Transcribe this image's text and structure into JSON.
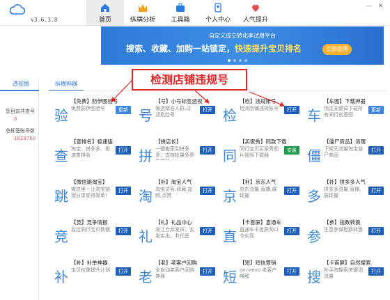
{
  "app": {
    "version": "v3.6.3.8"
  },
  "nav": {
    "items": [
      {
        "label": "首页",
        "icon": "home-icon",
        "active": true
      },
      {
        "label": "纵横分析",
        "icon": "analysis-icon",
        "active": false
      },
      {
        "label": "工具箱",
        "icon": "toolbox-icon",
        "active": false
      },
      {
        "label": "个人中心",
        "icon": "user-icon",
        "active": false
      },
      {
        "label": "人气提升",
        "icon": "popularity-icon",
        "active": false
      }
    ]
  },
  "banner": {
    "subtitle": "自定义成交转化率试用平台",
    "headline_part1": "搜索、收藏、加购一站锁定，",
    "headline_part2": "快速提升宝贝排名",
    "cta": "立即使用"
  },
  "left": {
    "tab": "透视镜",
    "stat1_label": "您目前共查号",
    "stat1_value": "0",
    "stat2_label": "总标签账号数",
    "stat2_value": "1629760"
  },
  "main": {
    "tab": "纵横神器"
  },
  "annotation": {
    "text": "检测店铺违规号"
  },
  "tools": [
    {
      "char": "验",
      "title": "【免费】防伊图验号",
      "desc": "免费防伊图验号",
      "button": "更新",
      "button_style": "light"
    },
    {
      "char": "号",
      "title": "【号】小号标签透视",
      "desc": "筛选精准人群,过滤危险号",
      "button": "打开",
      "button_style": "blue"
    },
    {
      "char": "检",
      "title": "【检】违规账号",
      "desc": "检测店铺违规账号",
      "button": "打开",
      "button_style": "blue"
    },
    {
      "char": "车",
      "title": "【车图】下载神器",
      "desc": "指定关键词下载所有同行创意图",
      "button": "更新",
      "button_style": "light"
    },
    {
      "char": "查",
      "title": "【查排名】极速版",
      "desc": "淘宝、拼多多、极速查排名",
      "button": "打开",
      "button_style": "blue"
    },
    {
      "char": "拼",
      "title": "【拼店长】",
      "desc": "一键搬家到拼多多，支持批量多票车神器",
      "button": "打开",
      "button_style": "blue"
    },
    {
      "char": "同",
      "title": "【买家秀】同款下载",
      "desc": "同行宝贝买家秀图片视频下载器",
      "button": "安装",
      "button_style": "green"
    },
    {
      "char": "僵",
      "title": "【僵尸商品】清理",
      "desc": "下架无流量淘宝僵尸商品",
      "button": "打开",
      "button_style": "blue"
    },
    {
      "char": "跳",
      "title": "【微信跳淘宝】",
      "desc": "微信里－让淘宝链接分享变得简单！",
      "button": "打开",
      "button_style": "blue"
    },
    {
      "char": "淘",
      "title": "【补】淘宝人气",
      "desc": "淘宝访客,收藏,加购,点赞",
      "button": "打开",
      "button_style": "blue"
    },
    {
      "char": "京",
      "title": "【补】京东人气",
      "desc": "京东流量,直播,展现量",
      "button": "打开",
      "button_style": "blue"
    },
    {
      "char": "多",
      "title": "【补】拼多多人气",
      "desc": "拼多多流量,直播,展现量",
      "button": "打开",
      "button_style": "blue"
    },
    {
      "char": "竞",
      "title": "【竞】竞争情报",
      "desc": "监控同行宝贝数据",
      "button": "打开",
      "button_style": "blue"
    },
    {
      "char": "礼",
      "title": "【礼】礼品中心",
      "desc": "浙江仓库发货，实发实出，非代签",
      "button": "打开",
      "button_style": "blue"
    },
    {
      "char": "直",
      "title": "【卡首屏】直通车",
      "desc": "直通车卡首屏淘口令实现",
      "button": "打开",
      "button_style": "blue"
    },
    {
      "char": "参",
      "title": "【参】指数转换",
      "desc": "生意参谋指数转换",
      "button": "打开",
      "button_style": "blue"
    },
    {
      "char": "补",
      "title": "【补】补单神器",
      "desc": "宝贝权重提升计划",
      "button": "打开",
      "button_style": "blue"
    },
    {
      "char": "老",
      "title": "【老】老客户回购",
      "desc": "全自动老客户回购神器",
      "button": "打开",
      "button_style": "blue"
    },
    {
      "char": "短",
      "title": "【短】短信营销",
      "desc": "активно 老客户唤醒",
      "button": "打开",
      "button_style": "blue"
    },
    {
      "char": "搜",
      "title": "【卡首屏】自然搜索",
      "desc": "补手淘搜索关键词流量",
      "button": "打开",
      "button_style": "blue"
    }
  ]
}
